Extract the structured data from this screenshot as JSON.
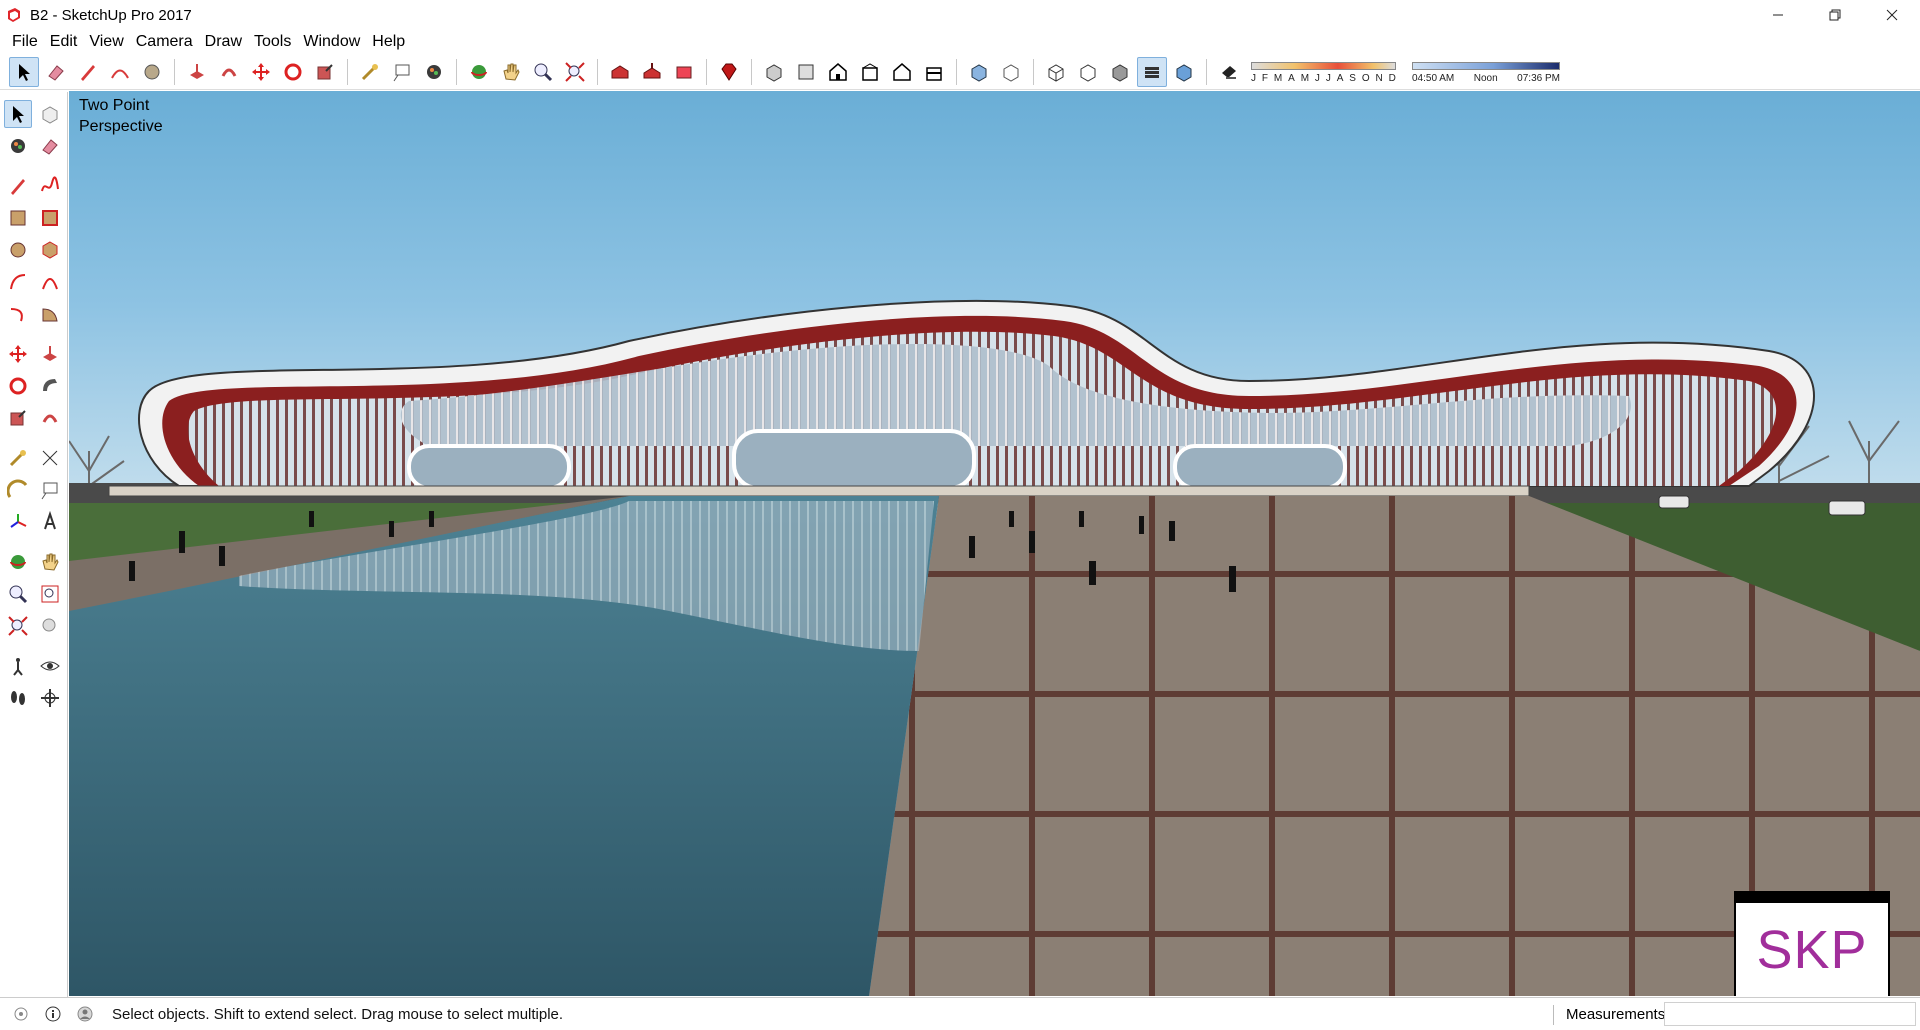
{
  "window": {
    "title": "B2 - SketchUp Pro 2017",
    "controls": [
      "minimize-icon",
      "restore-icon",
      "close-icon"
    ]
  },
  "menu": [
    "File",
    "Edit",
    "View",
    "Camera",
    "Draw",
    "Tools",
    "Window",
    "Help"
  ],
  "shadows": {
    "months": [
      "J",
      "F",
      "M",
      "A",
      "M",
      "J",
      "J",
      "A",
      "S",
      "O",
      "N",
      "D"
    ],
    "time_start": "04:50 AM",
    "time_mid": "Noon",
    "time_end": "07:36 PM"
  },
  "viewport": {
    "scene_label": "Two Point Perspective",
    "badge": "SKP",
    "sky_color": "#6fb1d8",
    "accent_red": "#8b1f1f"
  },
  "status": {
    "hint": "Select objects. Shift to extend select. Drag mouse to select multiple.",
    "measurements_label": "Measurements",
    "measurements_value": ""
  }
}
